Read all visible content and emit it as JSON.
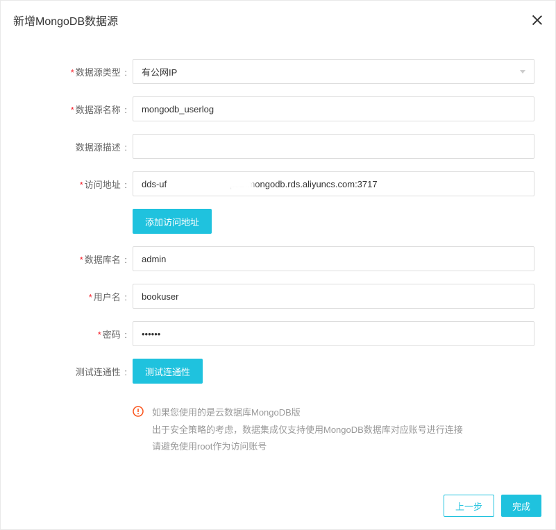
{
  "dialog": {
    "title": "新增MongoDB数据源"
  },
  "form": {
    "type": {
      "label": "数据源类型",
      "value": "有公网IP",
      "required": true
    },
    "name": {
      "label": "数据源名称",
      "value": "mongodb_userlog",
      "required": true
    },
    "desc": {
      "label": "数据源描述",
      "value": "",
      "required": false
    },
    "addr": {
      "label": "访问地址",
      "value": "dds-uf                        -pub.mongodb.rds.aliyuncs.com:3717",
      "required": true
    },
    "addAddr": "添加访问地址",
    "db": {
      "label": "数据库名",
      "value": "admin",
      "required": true
    },
    "user": {
      "label": "用户名",
      "value": "bookuser",
      "required": true
    },
    "pwd": {
      "label": "密码",
      "value": "••••••",
      "required": true
    },
    "test": {
      "label": "测试连通性",
      "button": "测试连通性"
    }
  },
  "notice": {
    "line1": "如果您使用的是云数据库MongoDB版",
    "line2": "出于安全策略的考虑，数据集成仅支持使用MongoDB数据库对应账号进行连接",
    "line3": "请避免使用root作为访问账号"
  },
  "footer": {
    "prev": "上一步",
    "done": "完成"
  }
}
